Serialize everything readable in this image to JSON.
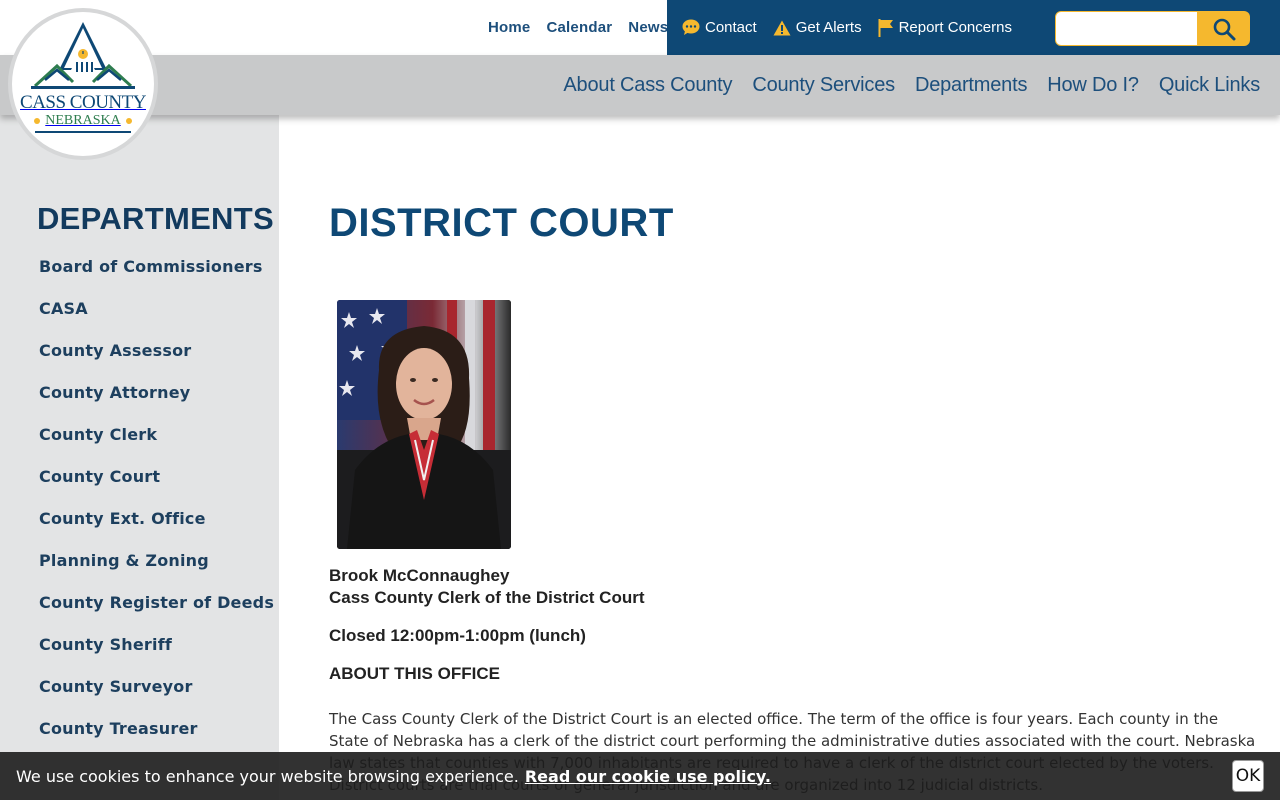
{
  "logo": {
    "line1": "CASS COUNTY",
    "line2": "NEBRASKA"
  },
  "utility_nav": {
    "links": [
      "Home",
      "Calendar",
      "News"
    ],
    "actions": [
      {
        "label": "Contact",
        "icon": "chat-bubble-icon"
      },
      {
        "label": "Get Alerts",
        "icon": "warning-icon"
      },
      {
        "label": "Report Concerns",
        "icon": "flag-icon"
      }
    ],
    "search": {
      "placeholder": "",
      "value": "",
      "icon": "search-icon"
    }
  },
  "main_nav": {
    "items": [
      "About Cass County",
      "County Services",
      "Departments",
      "How Do I?",
      "Quick Links"
    ]
  },
  "sidebar": {
    "title": "DEPARTMENTS",
    "items": [
      "Board of Commissioners",
      "CASA",
      "County Assessor",
      "County Attorney",
      "County Clerk",
      "County Court",
      "County Ext. Office",
      "Planning & Zoning",
      "County Register of Deeds",
      "County Sheriff",
      "County Surveyor",
      "County Treasurer"
    ]
  },
  "main": {
    "title": "DISTRICT COURT",
    "person_name": "Brook McConnaughey",
    "person_role": "Cass County Clerk of the District Court",
    "hours": "Closed 12:00pm-1:00pm (lunch)",
    "section_heading": "ABOUT THIS OFFICE",
    "body": "The Cass County Clerk of the District Court is an elected office. The term of the office is four years. Each county in the State of Nebraska has a clerk of the district court performing the administrative duties associated with the court. Nebraska law states that counties with 7,000 inhabitants are required to have a clerk of the district court elected by the voters. District courts are trial courts of general jurisdiction and are organized into 12 judicial districts."
  },
  "cookie_banner": {
    "text": "We use cookies to enhance your website browsing experience.",
    "link": "Read our cookie use policy.",
    "ok_label": "OK"
  },
  "colors": {
    "brand_blue": "#0e4875",
    "accent_yellow": "#f5b82e",
    "nav_gray": "#c8c9ca",
    "sidebar_gray": "#e3e4e5"
  }
}
